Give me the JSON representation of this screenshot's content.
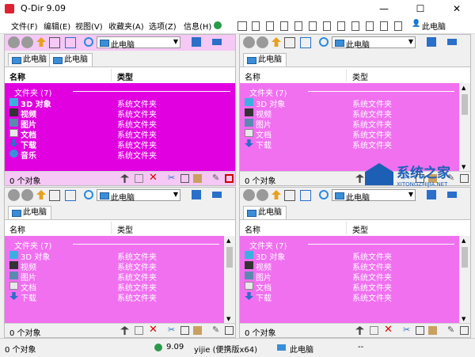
{
  "window": {
    "title": "Q-Dir 9.09",
    "minimize": "—",
    "maximize": "☐",
    "close": "✕"
  },
  "menu": [
    "文件(F)",
    "编辑(E)",
    "视图(V)",
    "收藏夹(A)",
    "选项(Z)",
    "信息(H)"
  ],
  "menu_toolbar": {
    "user_label": "此电脑"
  },
  "panes": [
    {
      "address": "此电脑",
      "tabs": [
        "此电脑",
        "此电脑"
      ],
      "active_tab": 1,
      "highlight": true,
      "columns": {
        "name": "名称",
        "type": "类型"
      },
      "group": "文件夹 (7)",
      "rows": [
        {
          "name": "3D 对象",
          "type": "系统文件夹",
          "icon": "3d-objects-icon"
        },
        {
          "name": "视频",
          "type": "系统文件夹",
          "icon": "video-icon"
        },
        {
          "name": "图片",
          "type": "系统文件夹",
          "icon": "pictures-icon"
        },
        {
          "name": "文档",
          "type": "系统文件夹",
          "icon": "documents-icon"
        },
        {
          "name": "下载",
          "type": "系统文件夹",
          "icon": "download-icon"
        },
        {
          "name": "音乐",
          "type": "系统文件夹",
          "icon": "music-icon"
        }
      ],
      "status": "0 个对象"
    },
    {
      "address": "此电脑",
      "tabs": [
        "此电脑"
      ],
      "active_tab": 0,
      "highlight": false,
      "columns": {
        "name": "名称",
        "type": "类型"
      },
      "group": "文件夹 (7)",
      "rows": [
        {
          "name": "3D 对象",
          "type": "系统文件夹",
          "icon": "3d-objects-icon"
        },
        {
          "name": "视频",
          "type": "系统文件夹",
          "icon": "video-icon"
        },
        {
          "name": "图片",
          "type": "系统文件夹",
          "icon": "pictures-icon"
        },
        {
          "name": "文档",
          "type": "系统文件夹",
          "icon": "documents-icon"
        },
        {
          "name": "下载",
          "type": "系统文件夹",
          "icon": "download-icon"
        }
      ],
      "status": "0 个对象"
    },
    {
      "address": "此电脑",
      "tabs": [
        "此电脑"
      ],
      "active_tab": 0,
      "highlight": false,
      "columns": {
        "name": "名称",
        "type": "类型"
      },
      "group": "文件夹 (7)",
      "rows": [
        {
          "name": "3D 对象",
          "type": "系统文件夹",
          "icon": "3d-objects-icon"
        },
        {
          "name": "视频",
          "type": "系统文件夹",
          "icon": "video-icon"
        },
        {
          "name": "图片",
          "type": "系统文件夹",
          "icon": "pictures-icon"
        },
        {
          "name": "文档",
          "type": "系统文件夹",
          "icon": "documents-icon"
        },
        {
          "name": "下载",
          "type": "系统文件夹",
          "icon": "download-icon"
        }
      ],
      "status": "0 个对象"
    },
    {
      "address": "此电脑",
      "tabs": [
        "此电脑"
      ],
      "active_tab": 0,
      "highlight": false,
      "columns": {
        "name": "名称",
        "type": "类型"
      },
      "group": "文件夹 (7)",
      "rows": [
        {
          "name": "3D 对象",
          "type": "系统文件夹",
          "icon": "3d-objects-icon"
        },
        {
          "name": "视频",
          "type": "系统文件夹",
          "icon": "video-icon"
        },
        {
          "name": "图片",
          "type": "系统文件夹",
          "icon": "pictures-icon"
        },
        {
          "name": "文档",
          "type": "系统文件夹",
          "icon": "documents-icon"
        },
        {
          "name": "下载",
          "type": "系统文件夹",
          "icon": "download-icon"
        }
      ],
      "status": "0 个对象"
    }
  ],
  "status_bar": {
    "objects": "0 个对象",
    "version": "9.09",
    "user": "yijie (便携版x64)",
    "location": "此电脑",
    "extra": "--"
  },
  "watermark": {
    "name": "系统之家",
    "url": "XITONGZHIJIA.NET"
  },
  "colors": {
    "highlight_bg": "#e000e0",
    "row_bg": "#f070f0",
    "active_toolbar": "#f5c8f5",
    "group_text": "#ffffff",
    "accent_blue": "#1d5fb5"
  }
}
